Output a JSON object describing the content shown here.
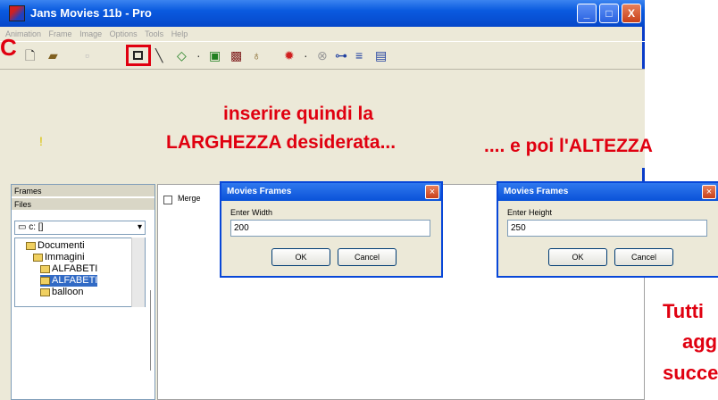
{
  "window": {
    "title": "Jans Movies 11b - Pro",
    "controls": {
      "minimize": "_",
      "maximize": "□",
      "close": "X"
    }
  },
  "menu": [
    "Animation",
    "Frame",
    "Image",
    "Options",
    "Tools",
    "Help"
  ],
  "toolbar_icons": [
    "new-icon",
    "open-icon",
    "frame-size-icon",
    "line-icon",
    "diamond-icon",
    "copy-icon",
    "delete-icon",
    "bulb-icon",
    "effects-icon",
    "stop-icon",
    "settings-icon",
    "list-icon",
    "film-icon"
  ],
  "left_panel": {
    "frames_header": "Frames",
    "files_header": "Files",
    "drive": "c: []",
    "tree": [
      "Documenti",
      "Immagini",
      "ALFABETI",
      "ALFABETI",
      "balloon"
    ],
    "selected_index": 3
  },
  "content": {
    "merge_label": "Merge"
  },
  "dialog_width": {
    "title": "Movies Frames",
    "label": "Enter Width",
    "value": "200",
    "ok": "OK",
    "cancel": "Cancel"
  },
  "dialog_height": {
    "title": "Movies Frames",
    "label": "Enter Height",
    "value": "250",
    "ok": "OK",
    "cancel": "Cancel"
  },
  "annotations": {
    "line1": "inserire quindi la",
    "line2": "LARGHEZZA desiderata...",
    "line3": ".... e poi l'ALTEZZA",
    "corner1": "Tutti",
    "corner2": "agg",
    "corner3": "succe",
    "edge_char": "C",
    "mark": "!"
  },
  "colors": {
    "annotation": "#e00010",
    "titlebar": "#0a5adf"
  }
}
